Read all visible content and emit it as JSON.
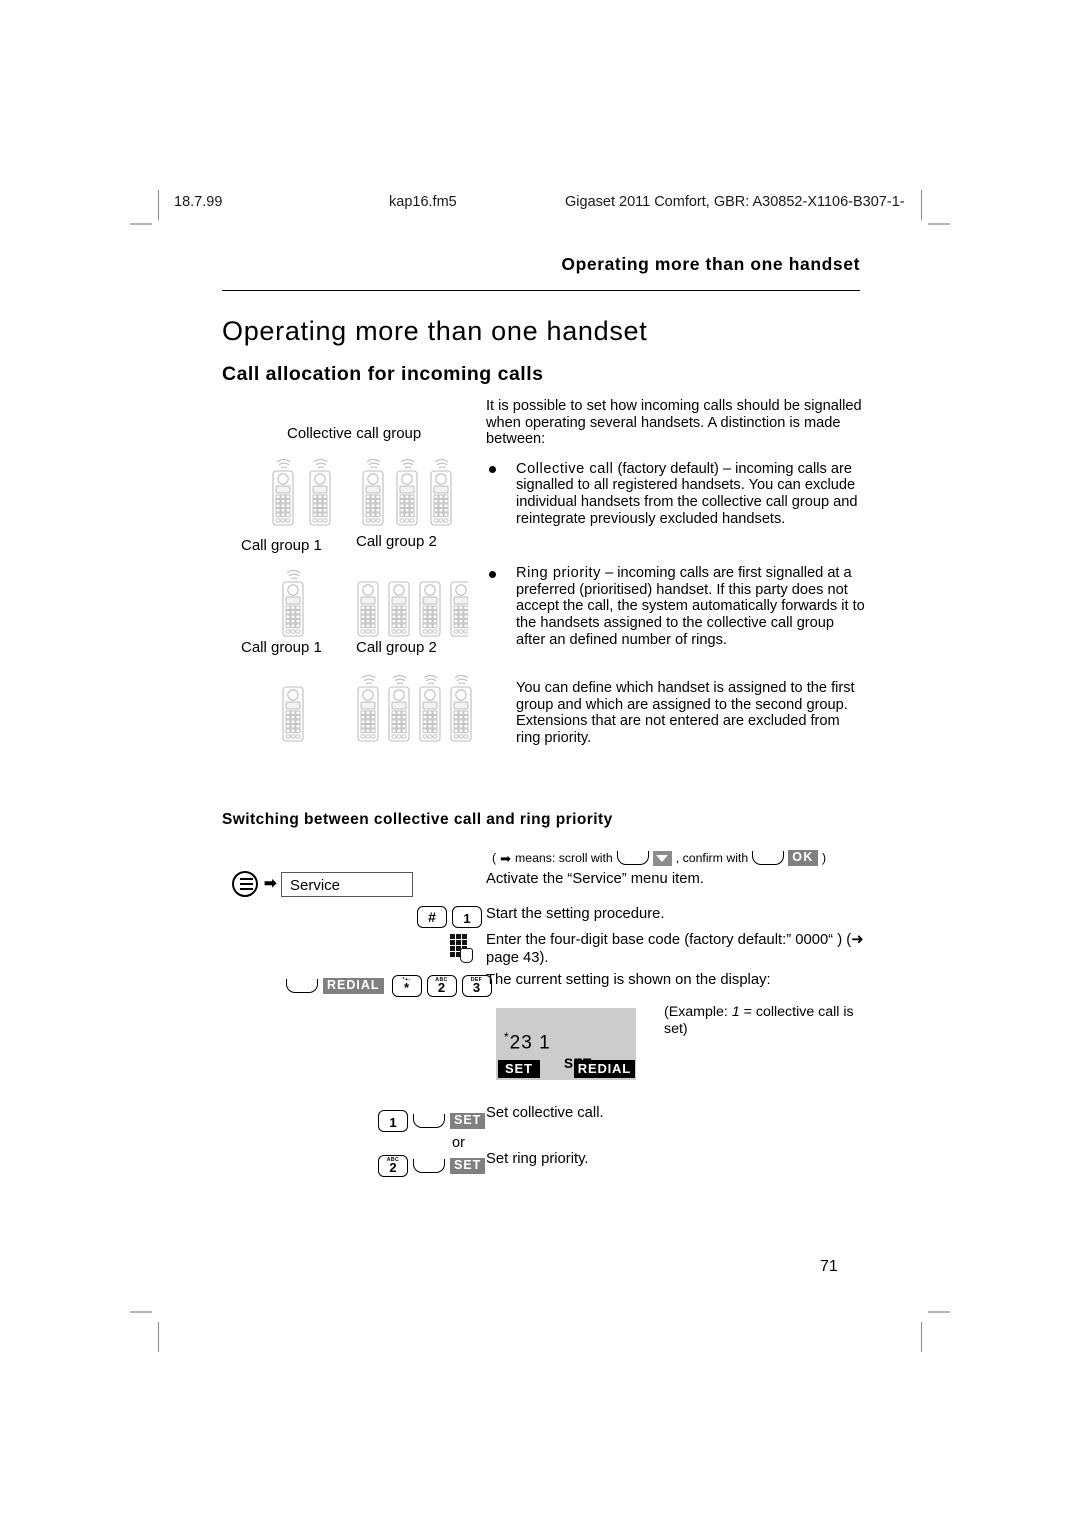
{
  "running_header": {
    "date": "18.7.99",
    "filename": "kap16.fm5",
    "reference": "Gigaset 2011 Comfort, GBR: A30852-X1106-B307-1-"
  },
  "chapter_header": "Operating more than one handset",
  "titles": {
    "h1": "Operating more than one handset",
    "h2": "Call allocation for incoming calls",
    "h3": "Switching between collective call and ring priority"
  },
  "intro": {
    "paragraph": "It is possible to set how incoming calls should be signalled when operating several handsets. A distinction is made between:",
    "bullets": [
      {
        "lead": "Collective call",
        "text": " (factory default) – incoming calls are signalled to all registered handsets. You can exclude individual handsets from the collective call group and reintegrate previously excluded handsets."
      },
      {
        "lead": "Ring priority",
        "text": " – incoming calls are first signalled at a preferred (prioritised) handset. If this party does not accept the call, the system automatically forwards it to the handsets assigned to the collective call group after an defined number of rings."
      }
    ],
    "closing": "You can define which handset is assigned to the first group and which are assigned to the second group. Extensions that are not entered are excluded from ring priority."
  },
  "diagram": {
    "label_collective": "Collective call group",
    "label_group1_a": "Call group 1",
    "label_group2_a": "Call group 2",
    "label_group1_b": "Call group 1",
    "label_group2_b": "Call group 2"
  },
  "procedure": {
    "scroll_note": {
      "open": "(",
      "arrow": "➡",
      "means": "means: scroll with",
      "confirm": ", confirm with",
      "ok": "OK",
      "close": ")"
    },
    "steps": [
      {
        "label": "Service",
        "text": "Activate the “Service” menu item."
      },
      {
        "keys": [
          "#",
          "1"
        ],
        "text": "Start the setting procedure."
      },
      {
        "text": "Enter the four-digit base code (factory default:” 0000“ ) (➜ page 43)."
      },
      {
        "softkey": "REDIAL",
        "keys": [
          "*",
          "2",
          "3"
        ],
        "text": "The current setting is shown on the display:"
      },
      {
        "keys": [
          "1"
        ],
        "softkey": "SET",
        "text": "Set collective call."
      },
      {
        "keys": [
          "2"
        ],
        "softkey": "SET",
        "text": "Set ring priority."
      }
    ],
    "or_label": "or",
    "redial_chip": "REDIAL",
    "set_chip": "SET",
    "key_hash": "#",
    "key_1": "1",
    "key_2": "2",
    "key_3": "3",
    "key_star": "*",
    "key_2_abc": "ABC",
    "key_3_abc": "DEF",
    "key_star_abc": "*+-"
  },
  "display_mock": {
    "line": "23  1",
    "star": "*",
    "mid_label": "SET",
    "softkey_left": "SET",
    "softkey_right": "REDIAL",
    "example_note_prefix": "(Example: ",
    "example_note_italic": "1",
    "example_note_suffix": " = collective call is set)"
  },
  "page_number": "71",
  "colors": {
    "display_bg": "#cccccc",
    "chip_gray": "#808080",
    "chip_black": "#000000",
    "handset_gray": "#c8c8c8"
  }
}
